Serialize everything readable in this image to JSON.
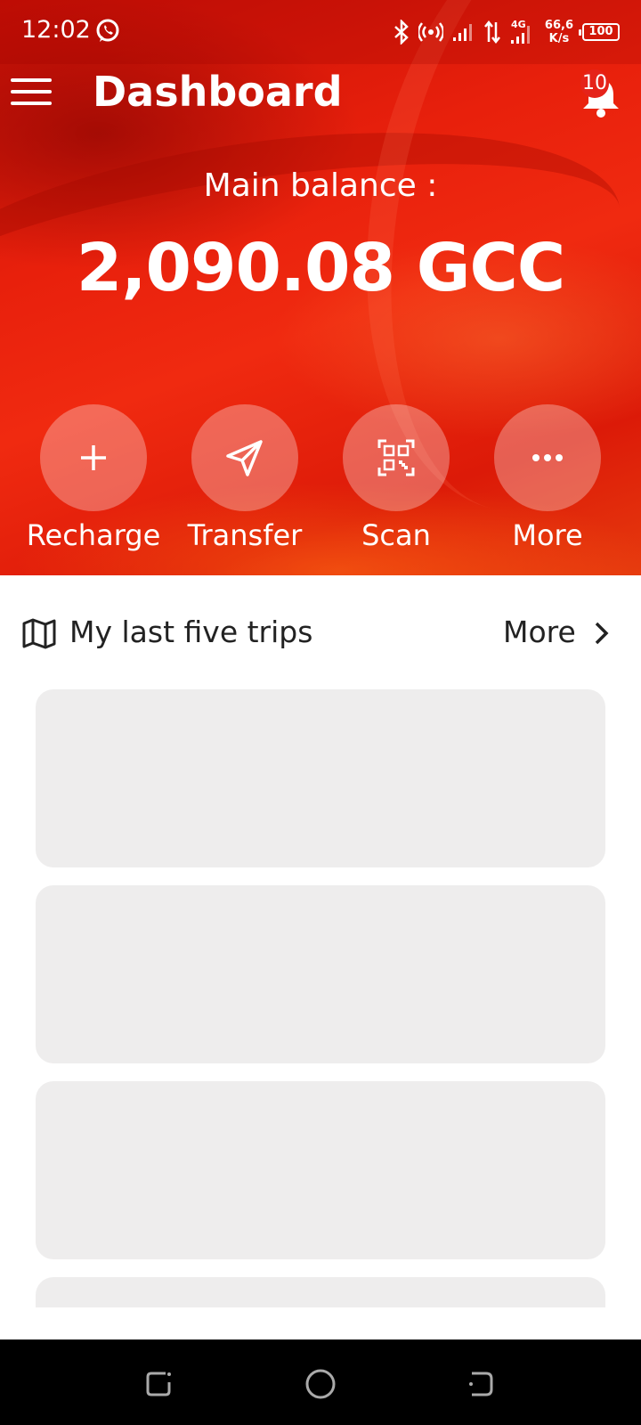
{
  "status": {
    "time": "12:02",
    "net_speed_value": "66,6",
    "net_speed_unit": "K/s",
    "network_type": "4G",
    "battery": "100",
    "icons": [
      "whatsapp-icon",
      "bluetooth-icon",
      "hotspot-icon",
      "signal-icon",
      "data-arrows-icon",
      "signal-4g-icon"
    ]
  },
  "appbar": {
    "title": "Dashboard",
    "notification_count": "10"
  },
  "balance": {
    "label": "Main balance :",
    "value": "2,090.08 GCC"
  },
  "actions": [
    {
      "label": "Recharge",
      "icon": "plus-icon"
    },
    {
      "label": "Transfer",
      "icon": "send-icon"
    },
    {
      "label": "Scan",
      "icon": "qr-scan-icon"
    },
    {
      "label": "More",
      "icon": "more-dots-icon"
    }
  ],
  "trips": {
    "title": "My last five trips",
    "more_label": "More",
    "icon": "map-icon"
  },
  "colors": {
    "brand_red": "#e8200c",
    "card_placeholder": "#eeeded"
  }
}
